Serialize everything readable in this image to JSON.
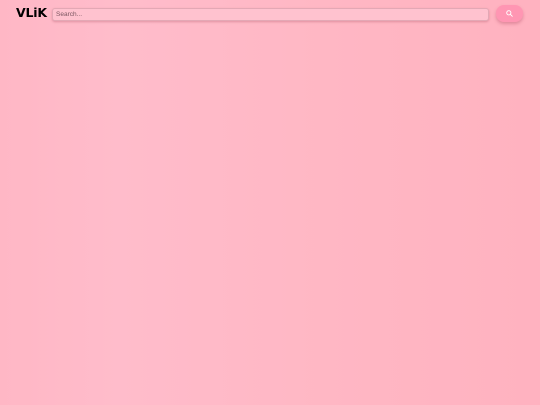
{
  "brand": {
    "logo_text": "VLiK"
  },
  "search": {
    "placeholder": "Search...",
    "value": ""
  },
  "search_button": {
    "icon": "search-icon"
  },
  "colors": {
    "background": "#ffb7c5",
    "search_field": "#ffc2cf",
    "button": "#ff96b3",
    "logo": "#000000"
  }
}
